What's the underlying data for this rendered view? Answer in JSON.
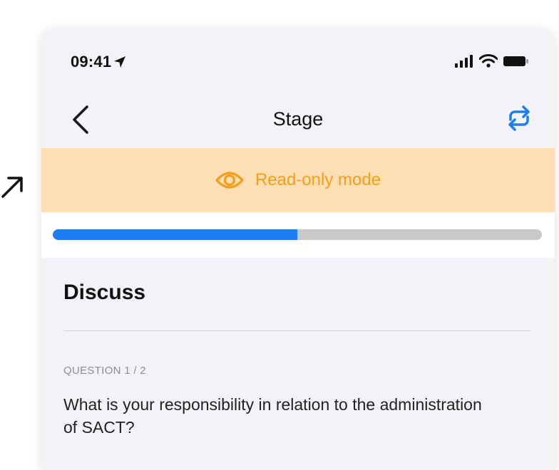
{
  "status_bar": {
    "time": "09:41",
    "icons": [
      "location-arrow-icon",
      "cellular-signal-icon",
      "wifi-icon",
      "battery-icon"
    ]
  },
  "nav": {
    "title": "Stage",
    "back_icon": "chevron-left-icon",
    "sync_icon": "sync-icon"
  },
  "banner": {
    "text": "Read-only mode",
    "icon": "eye-icon",
    "text_color": "#f59e1c",
    "background": "#fddfb3"
  },
  "progress": {
    "fraction": 0.5,
    "fill_color": "#1b7ef3",
    "track_color": "#c9c9c9"
  },
  "section": {
    "title": "Discuss"
  },
  "question": {
    "counter": "QUESTION 1 / 2",
    "text": "What is your responsibility in relation to the administration of SACT?"
  }
}
